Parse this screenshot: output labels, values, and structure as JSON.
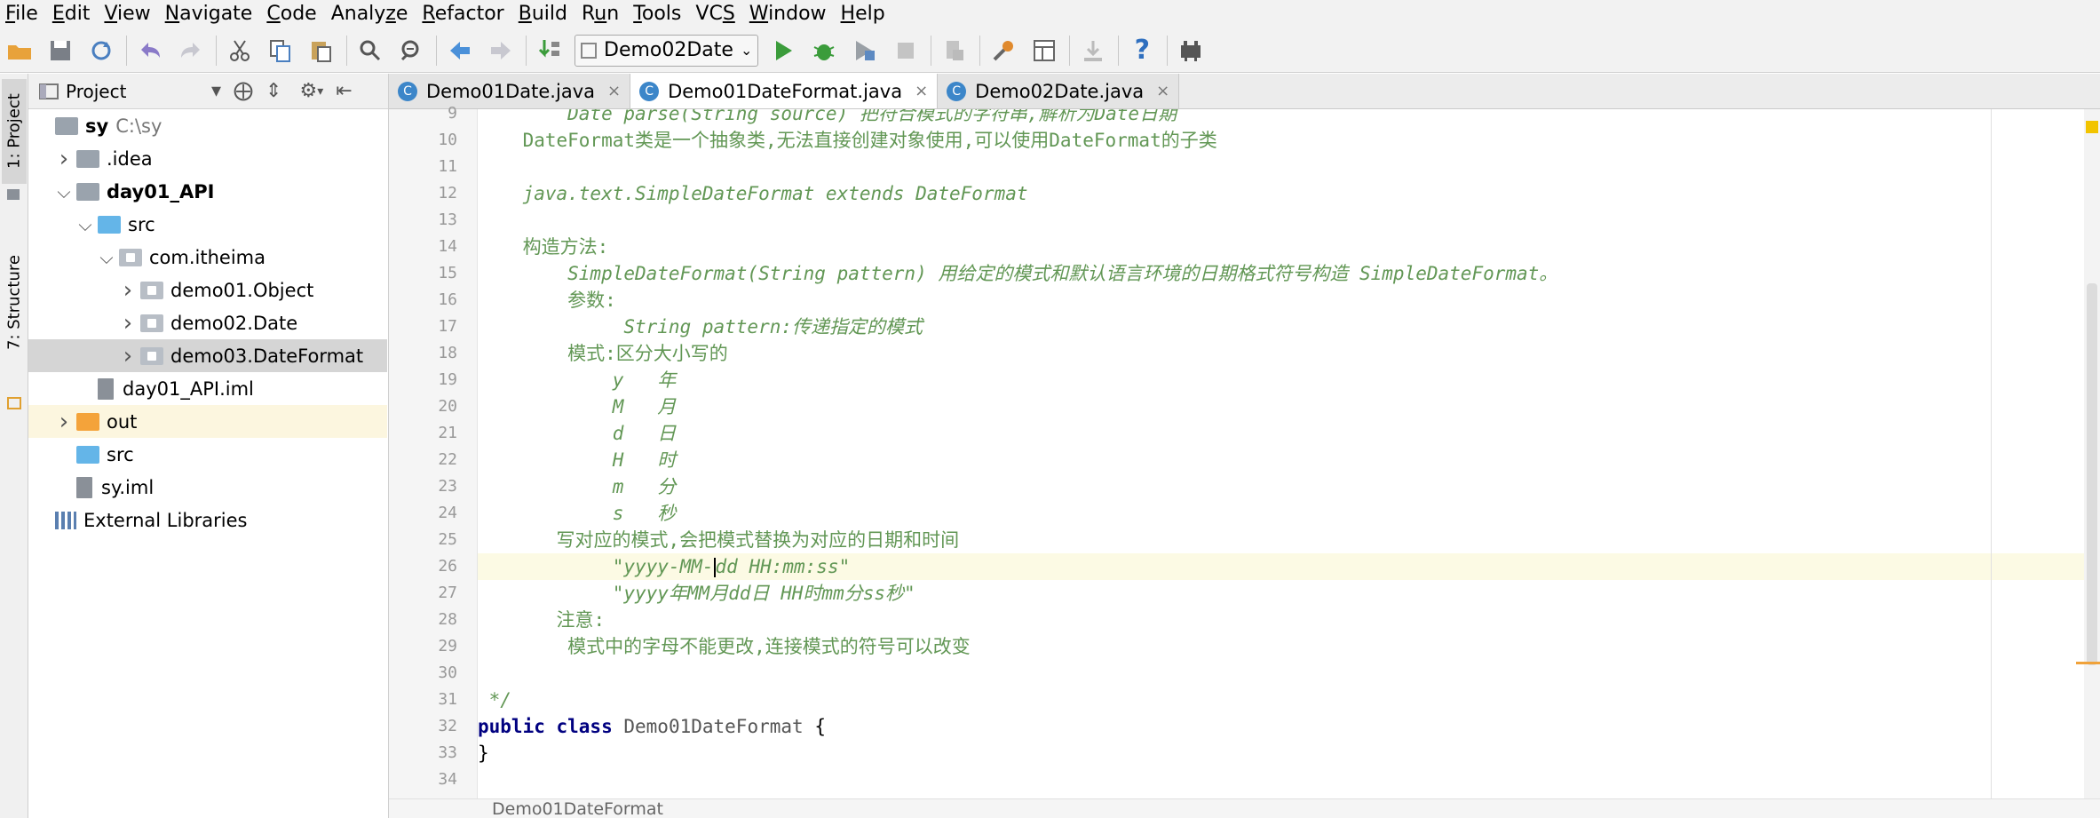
{
  "menu": [
    {
      "pre": "",
      "u": "F",
      "post": "ile"
    },
    {
      "pre": "",
      "u": "E",
      "post": "dit"
    },
    {
      "pre": "",
      "u": "V",
      "post": "iew"
    },
    {
      "pre": "",
      "u": "N",
      "post": "avigate"
    },
    {
      "pre": "",
      "u": "C",
      "post": "ode"
    },
    {
      "pre": "Analy",
      "u": "z",
      "post": "e"
    },
    {
      "pre": "",
      "u": "R",
      "post": "efactor"
    },
    {
      "pre": "",
      "u": "B",
      "post": "uild"
    },
    {
      "pre": "R",
      "u": "u",
      "post": "n"
    },
    {
      "pre": "",
      "u": "T",
      "post": "ools"
    },
    {
      "pre": "VC",
      "u": "S",
      "post": ""
    },
    {
      "pre": "",
      "u": "W",
      "post": "indow"
    },
    {
      "pre": "",
      "u": "H",
      "post": "elp"
    }
  ],
  "toolbar": {
    "run_config": "Demo02Date",
    "help_glyph": "?"
  },
  "left_strip": {
    "project_tab": "1: Project",
    "structure_tab": "7: Structure"
  },
  "project_panel": {
    "title": "Project",
    "tree": [
      {
        "label": "sy",
        "extra": "C:\\sy",
        "indent": 0,
        "arrow": "",
        "icon": "gray",
        "bold": true
      },
      {
        "label": ".idea",
        "indent": 1,
        "arrow": ">",
        "icon": "gray"
      },
      {
        "label": "day01_API",
        "indent": 1,
        "arrow": "v",
        "icon": "gray",
        "bold": true
      },
      {
        "label": "src",
        "indent": 2,
        "arrow": "v",
        "icon": "blue"
      },
      {
        "label": "com.itheima",
        "indent": 3,
        "arrow": "v",
        "icon": "pkg"
      },
      {
        "label": "demo01.Object",
        "indent": 4,
        "arrow": ">",
        "icon": "pkg"
      },
      {
        "label": "demo02.Date",
        "indent": 4,
        "arrow": ">",
        "icon": "pkg"
      },
      {
        "label": "demo03.DateFormat",
        "indent": 4,
        "arrow": ">",
        "icon": "pkg",
        "selected": true
      },
      {
        "label": "day01_API.iml",
        "indent": 2,
        "arrow": "",
        "icon": "file"
      },
      {
        "label": "out",
        "indent": 1,
        "arrow": ">",
        "icon": "orange",
        "highlight": true
      },
      {
        "label": "src",
        "indent": 1,
        "arrow": "",
        "icon": "blue"
      },
      {
        "label": "sy.iml",
        "indent": 1,
        "arrow": "",
        "icon": "file"
      },
      {
        "label": "External Libraries",
        "indent": 0,
        "arrow": "",
        "icon": "lib"
      }
    ]
  },
  "tabs": [
    {
      "label": "Demo01Date.java",
      "active": false
    },
    {
      "label": "Demo01DateFormat.java",
      "active": true
    },
    {
      "label": "Demo02Date.java",
      "active": false
    }
  ],
  "code": [
    {
      "n": "9",
      "text": "        Date parse(String source) 把符合模式的字符串,解析为Date日期",
      "cls": "cmt"
    },
    {
      "n": "10",
      "text": "    DateFormat类是一个抽象类,无法直接创建对象使用,可以使用DateFormat的子类",
      "cls": "cmt-n"
    },
    {
      "n": "11",
      "text": "",
      "cls": ""
    },
    {
      "n": "12",
      "text": "    java.text.SimpleDateFormat extends DateFormat",
      "cls": "cmt"
    },
    {
      "n": "13",
      "text": "",
      "cls": ""
    },
    {
      "n": "14",
      "text": "    构造方法:",
      "cls": "cmt-n"
    },
    {
      "n": "15",
      "text": "        SimpleDateFormat(String pattern) 用给定的模式和默认语言环境的日期格式符号构造 SimpleDateFormat。",
      "cls": "cmt"
    },
    {
      "n": "16",
      "text": "        参数:",
      "cls": "cmt-n"
    },
    {
      "n": "17",
      "text": "             String pattern:传递指定的模式",
      "cls": "cmt"
    },
    {
      "n": "18",
      "text": "        模式:区分大小写的",
      "cls": "cmt-n"
    },
    {
      "n": "19",
      "text": "            y   年",
      "cls": "cmt"
    },
    {
      "n": "20",
      "text": "            M   月",
      "cls": "cmt"
    },
    {
      "n": "21",
      "text": "            d   日",
      "cls": "cmt"
    },
    {
      "n": "22",
      "text": "            H   时",
      "cls": "cmt"
    },
    {
      "n": "23",
      "text": "            m   分",
      "cls": "cmt"
    },
    {
      "n": "24",
      "text": "            s   秒",
      "cls": "cmt"
    },
    {
      "n": "25",
      "text": "       写对应的模式,会把模式替换为对应的日期和时间",
      "cls": "cmt-n"
    },
    {
      "n": "26",
      "pre": "            \"yyyy-MM-",
      "post": "dd HH:mm:ss\"",
      "cls": "cmt",
      "current": true
    },
    {
      "n": "27",
      "text": "            \"yyyy年MM月dd日 HH时mm分ss秒\"",
      "cls": "cmt"
    },
    {
      "n": "28",
      "text": "       注意:",
      "cls": "cmt-n"
    },
    {
      "n": "29",
      "text": "        模式中的字母不能更改,连接模式的符号可以改变",
      "cls": "cmt-n"
    },
    {
      "n": "30",
      "text": "",
      "cls": ""
    },
    {
      "n": "31",
      "text": " */",
      "cls": "cmt"
    },
    {
      "n": "32",
      "kw": "public class ",
      "cls_name": "Demo01DateFormat",
      "rest": " {",
      "cls": "decl"
    },
    {
      "n": "33",
      "text": "}",
      "cls": "plain"
    },
    {
      "n": "34",
      "text": "",
      "cls": ""
    }
  ],
  "breadcrumb": "Demo01DateFormat"
}
